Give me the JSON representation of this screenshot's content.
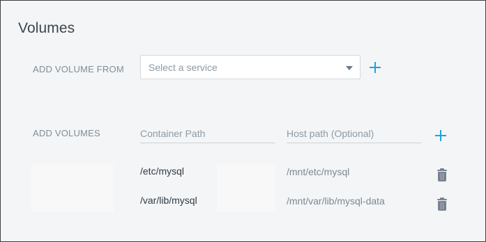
{
  "section": {
    "title": "Volumes"
  },
  "add_volume_from": {
    "label": "ADD VOLUME FROM",
    "select_placeholder": "Select a service"
  },
  "add_volumes": {
    "label": "ADD VOLUMES",
    "container_path_placeholder": "Container Path",
    "host_path_placeholder": "Host path (Optional)"
  },
  "volumes": [
    {
      "container_path": "/etc/mysql",
      "host_path": "/mnt/etc/mysql"
    },
    {
      "container_path": "/var/lib/mysql",
      "host_path": "/mnt/var/lib/mysql-data"
    }
  ],
  "colors": {
    "accent": "#1aa3e3",
    "panel_background": "#f4f5f6",
    "label": "#7f8d99",
    "trash_icon": "#7a8490"
  },
  "icons": {
    "add": "plus-icon",
    "dropdown": "caret-down-icon",
    "delete": "trash-icon"
  }
}
